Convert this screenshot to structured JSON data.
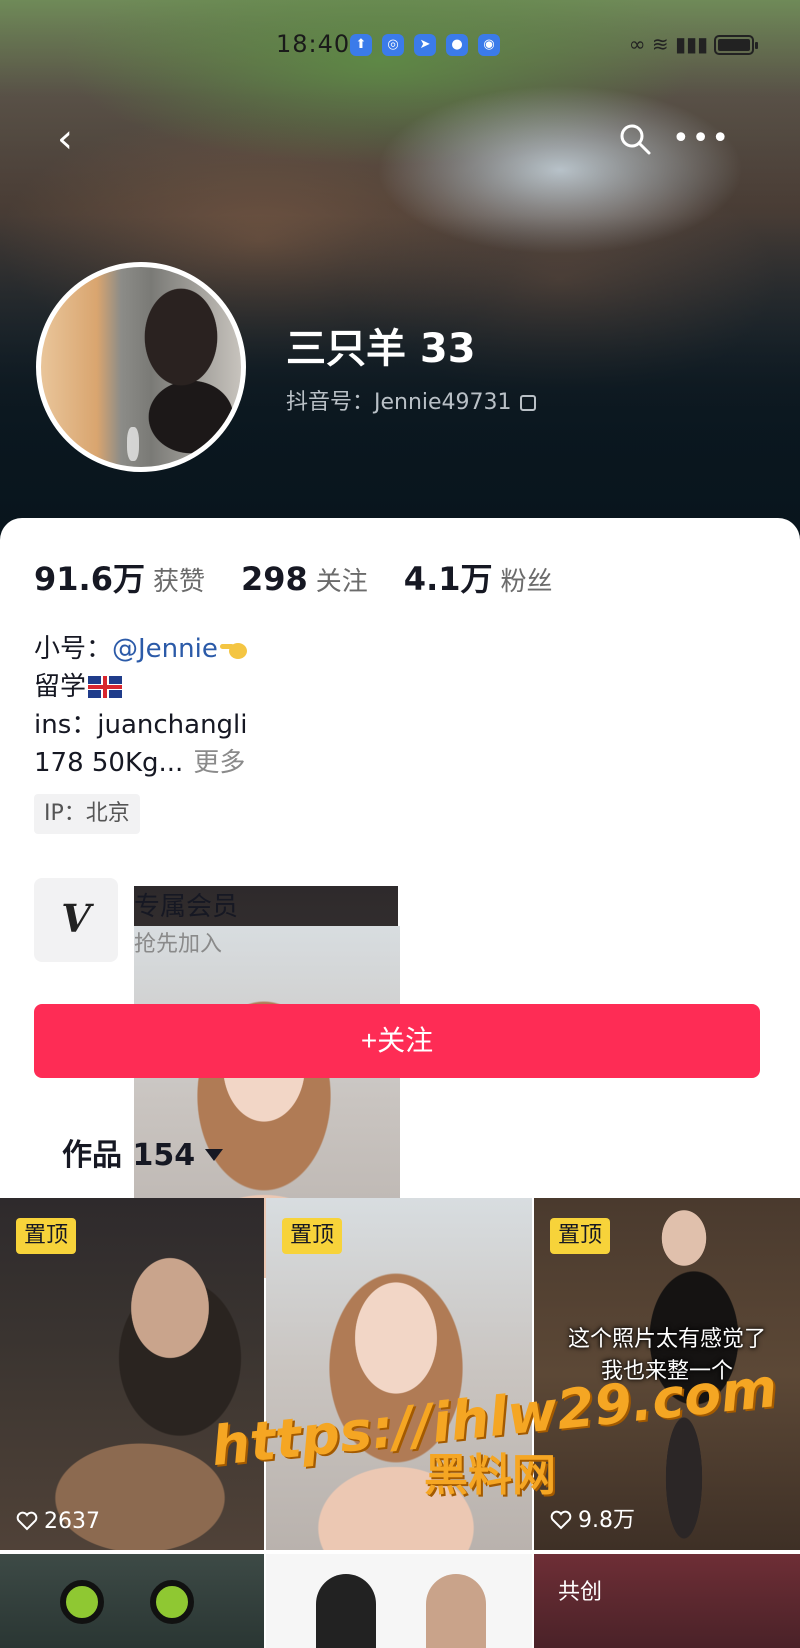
{
  "status_bar": {
    "time": "18:40"
  },
  "profile": {
    "name": "三只羊 33",
    "douyin_id": "抖音号：Jennie49731",
    "stats": [
      {
        "value": "91.6万",
        "label": "获赞"
      },
      {
        "value": "298",
        "label": "关注"
      },
      {
        "value": "4.1万",
        "label": "粉丝"
      }
    ],
    "bio": {
      "line1_prefix": "小号：",
      "line1_mention": "@Jennie",
      "line2": "留学",
      "line3": "ins：juanchangli",
      "line4": "178 50Kg...",
      "more": "更多"
    },
    "ip": "IP：北京"
  },
  "membership": {
    "icon_letter": "V",
    "title": "专属会员",
    "subtitle": "抢先加入"
  },
  "follow_button": "+关注",
  "works": {
    "label": "作品 154"
  },
  "grid": [
    {
      "pin": "置顶",
      "likes": "2637"
    },
    {
      "pin": "置顶",
      "likes": ""
    },
    {
      "pin": "置顶",
      "likes": "9.8万",
      "caption_line1": "这个照片太有感觉了",
      "caption_line2": "我也来整一个"
    },
    {},
    {},
    {
      "tag": "共创"
    }
  ],
  "watermark": {
    "url": "https://ihlw29.com",
    "site": "黑料网"
  },
  "colors": {
    "follow_bg": "#fe2c55",
    "pin_bg": "#f7d33a",
    "watermark": "#f5a623",
    "mention": "#2b5aa8"
  }
}
